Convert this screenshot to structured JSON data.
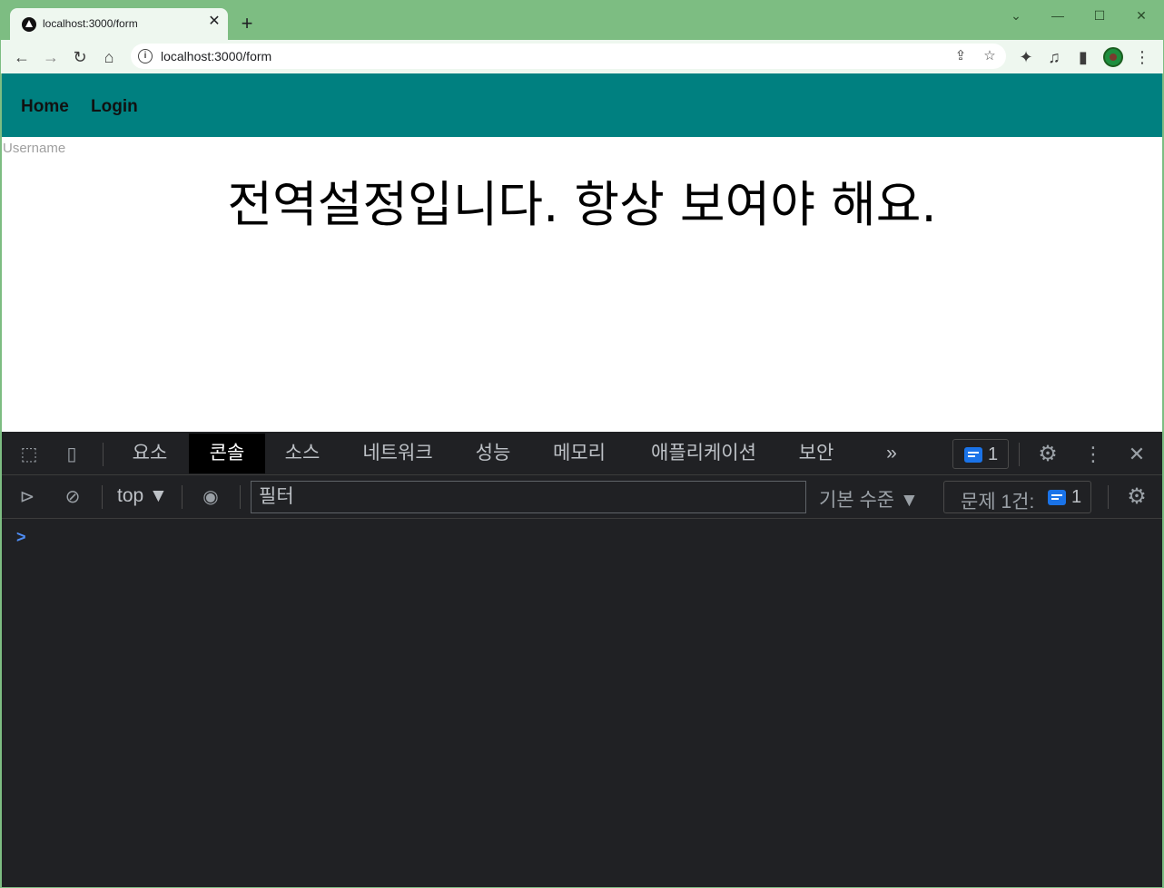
{
  "browser": {
    "tab_title": "localhost:3000/form",
    "tab_close": "✕",
    "new_tab": "+",
    "window_controls": {
      "tab_search": "⌄",
      "minimize": "—",
      "maximize": "☐",
      "close": "✕"
    },
    "url": "localhost:3000/form",
    "nav_icons": {
      "back": "←",
      "forward": "→",
      "reload": "↻",
      "home": "⌂",
      "share": "⇪",
      "bookmark": "☆",
      "extensions": "✦",
      "media": "♫",
      "sidepanel": "▮",
      "menu": "⋮"
    }
  },
  "page": {
    "nav_links": [
      "Home",
      "Login"
    ],
    "username_label": "Username",
    "headline": "전역설정입니다. 항상 보여야 해요."
  },
  "devtools": {
    "tabs": [
      "요소",
      "콘솔",
      "소스",
      "네트워크",
      "성능",
      "메모리",
      "애플리케이션",
      "보안"
    ],
    "active_tab": "콘솔",
    "more_tabs": "»",
    "issue_count": "1",
    "console": {
      "context": "top ▼",
      "filter_placeholder": "필터",
      "level": "기본 수준 ▼",
      "issues_label": "문제 1건:",
      "issues_count": "1",
      "prompt": ">"
    },
    "accent_color": "#1a73e8"
  },
  "colors": {
    "frame": "#7dbd82",
    "navbar": "#008080",
    "devtools_bg": "#202124"
  }
}
